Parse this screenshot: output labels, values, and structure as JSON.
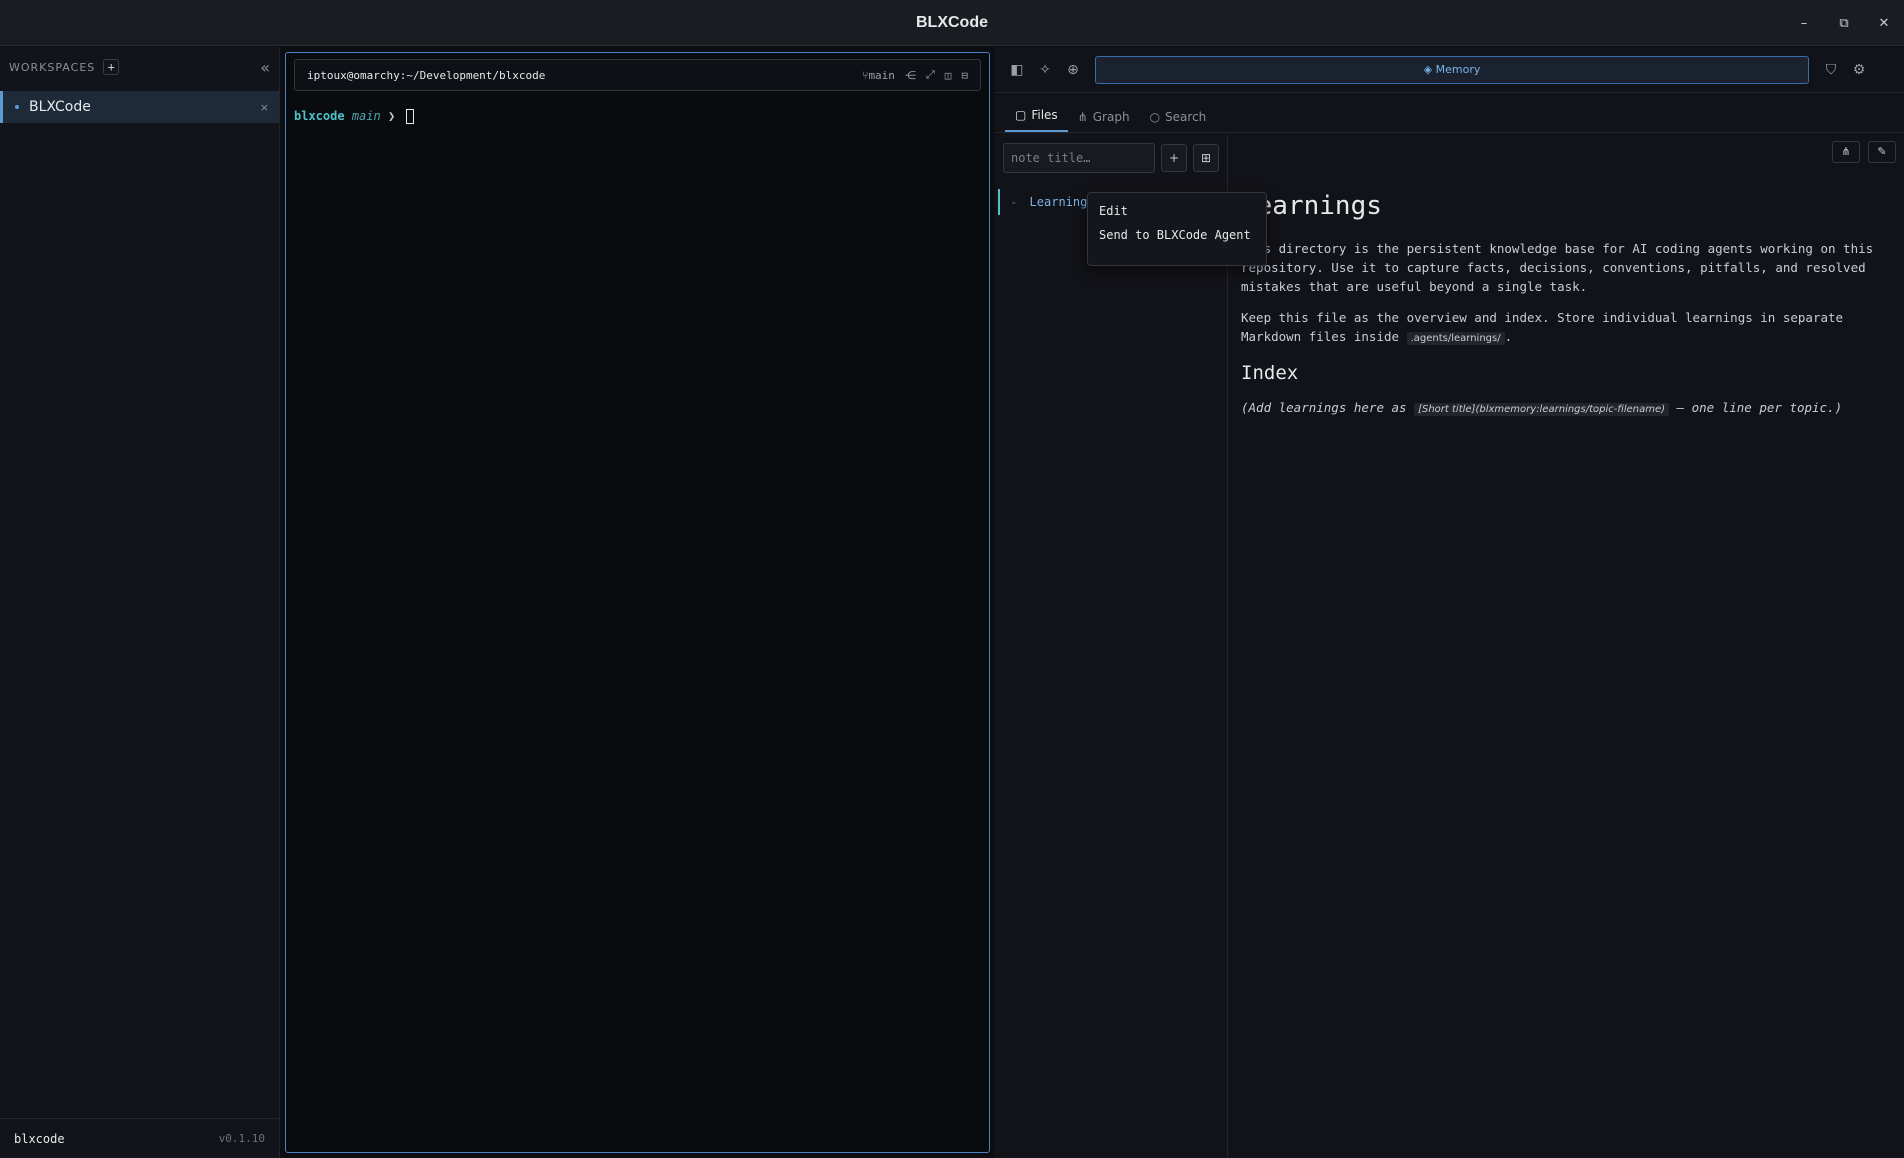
{
  "window": {
    "title": "BLXCode",
    "controls": {
      "minimize": "–",
      "maximize": "⧉",
      "close": "✕"
    }
  },
  "sidebar": {
    "header_label": "WORKSPACES",
    "add_label": "+",
    "collapse_label": "«",
    "workspaces": [
      {
        "name": "BLXCode",
        "close": "×"
      }
    ],
    "footer": {
      "project": "blxcode",
      "version": "v0.1.10"
    }
  },
  "terminal": {
    "path": "iptoux@omarchy:~/Development/blxcode",
    "branch_label": "main",
    "prompt": {
      "dir": "blxcode",
      "branch": "main",
      "symbol": "❯"
    }
  },
  "right_panel": {
    "memory_label": "Memory",
    "tabs": [
      {
        "label": "Files",
        "icon": "file-icon"
      },
      {
        "label": "Graph",
        "icon": "graph-icon"
      },
      {
        "label": "Search",
        "icon": "search-icon"
      }
    ],
    "note_input": {
      "placeholder": "note title…",
      "value": ""
    },
    "add_note_label": "+",
    "tree": [
      {
        "label": "Learnings"
      }
    ],
    "context_menu": [
      "Edit",
      "Send to BLXCode Agent"
    ],
    "document": {
      "title": "Learnings",
      "p1": "This directory is the persistent knowledge base for AI coding agents working on this repository. Use it to capture facts, decisions, conventions, pitfalls, and resolved mistakes that are useful beyond a single task.",
      "p2_before": "Keep this file as the overview and index. Store individual learnings in separate Markdown files inside ",
      "p2_code": ".agents/learnings/",
      "p2_after": ".",
      "h2": "Index",
      "p3_before": "(Add learnings here as ",
      "p3_code": "[Short title](blxmemory:learnings/topic-filename)",
      "p3_after": " — one line per topic.)"
    }
  },
  "colors": {
    "accent": "#5b9bd5",
    "teal": "#4fc3c9",
    "memory": "#7ab3e8"
  }
}
